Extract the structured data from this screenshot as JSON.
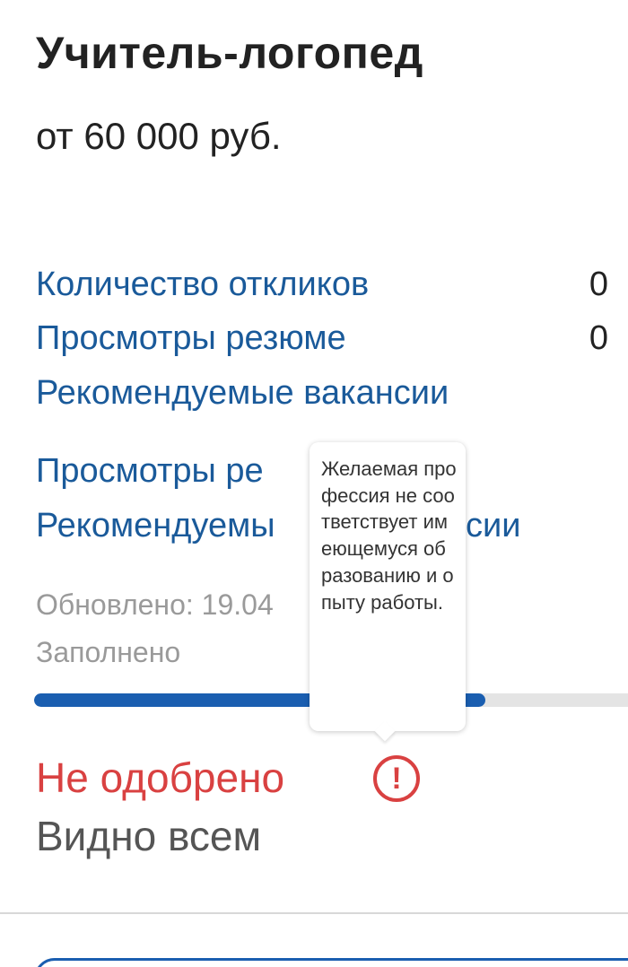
{
  "resume": {
    "title": "Учитель-логопед",
    "salary": "от 60 000 руб."
  },
  "stats": {
    "responses_label": "Количество откликов",
    "responses_count": "0",
    "views_label": "Просмотры резюме",
    "views_count": "0",
    "recommended_label": "Рекомендуемые вакансии",
    "views_label_2": "Просмотры ре",
    "recommended_label_2a": "Рекомендуемы",
    "recommended_label_2b": "сии"
  },
  "meta": {
    "updated": "Обновлено: 19.04",
    "filled_label": "Заполнено"
  },
  "progress": {
    "filled_fraction": 0.75
  },
  "status": {
    "text": "Не одобрено",
    "icon": "exclamation-circle-icon",
    "icon_glyph": "!",
    "visibility": "Видно всем"
  },
  "tooltip": {
    "text": "Желаемая профессия не соответствует имеющемуся образованию и опыту работы."
  },
  "colors": {
    "link": "#1a5a9a",
    "progress": "#1a5eb0",
    "error": "#d94141",
    "muted": "#9a9a9a"
  }
}
